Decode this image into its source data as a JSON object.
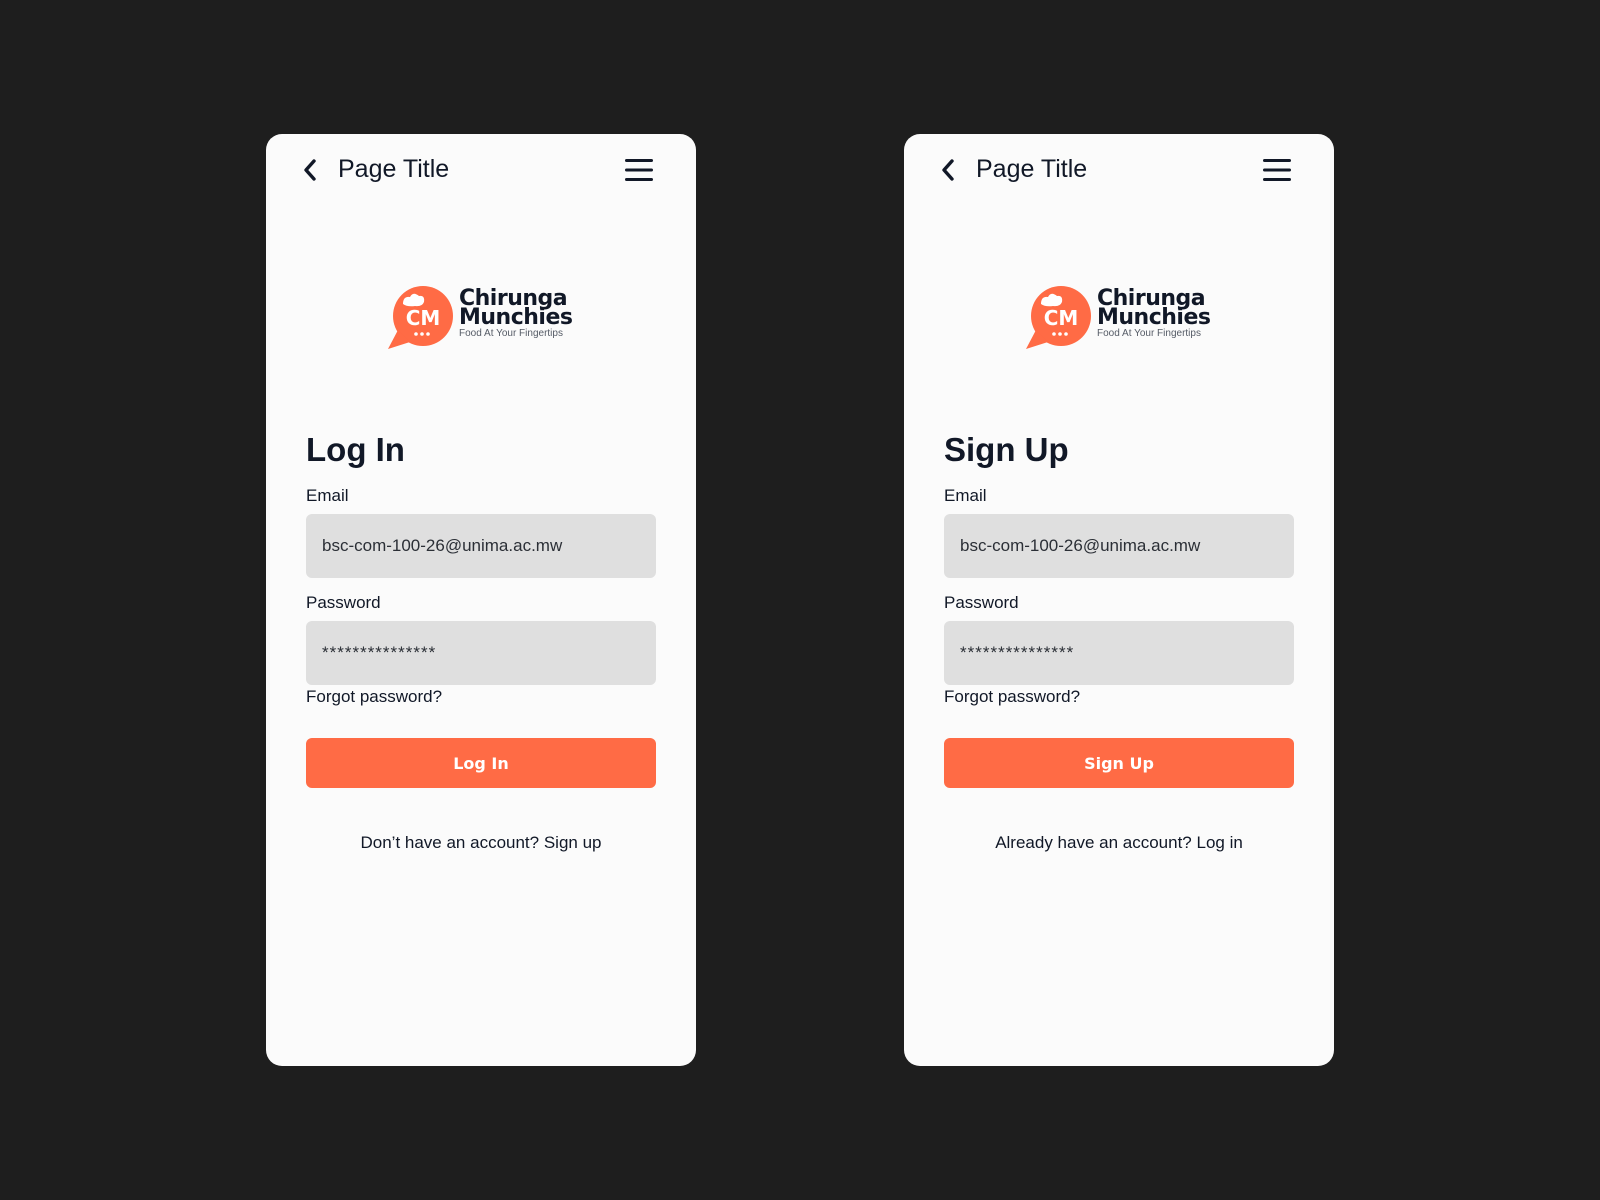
{
  "colors": {
    "background": "#1e1e1e",
    "card": "#fbfbfb",
    "accent": "#ff6b45",
    "input_fill": "#dfdfdf",
    "text": "#111827"
  },
  "login": {
    "nav": {
      "title": "Page Title",
      "back_icon": "chevron-left-icon",
      "menu_icon": "hamburger-menu-icon"
    },
    "logo": {
      "monogram": "CM",
      "line1": "Chirunga",
      "line2": "Munchies",
      "tagline": "Food At Your Fingertips"
    },
    "heading": "Log In",
    "email": {
      "label": "Email",
      "value": "bsc-com-100-26@unima.ac.mw"
    },
    "password": {
      "label": "Password",
      "value": "***************"
    },
    "forgot_link": "Forgot password?",
    "submit_label": "Log In",
    "footer": "Don’t have an account? Sign up"
  },
  "signup": {
    "nav": {
      "title": "Page Title",
      "back_icon": "chevron-left-icon",
      "menu_icon": "hamburger-menu-icon"
    },
    "logo": {
      "monogram": "CM",
      "line1": "Chirunga",
      "line2": "Munchies",
      "tagline": "Food At Your Fingertips"
    },
    "heading": "Sign Up",
    "email": {
      "label": "Email",
      "value": "bsc-com-100-26@unima.ac.mw"
    },
    "password": {
      "label": "Password",
      "value": "***************"
    },
    "forgot_link": "Forgot password?",
    "submit_label": "Sign Up",
    "footer": "Already have an account? Log in"
  }
}
